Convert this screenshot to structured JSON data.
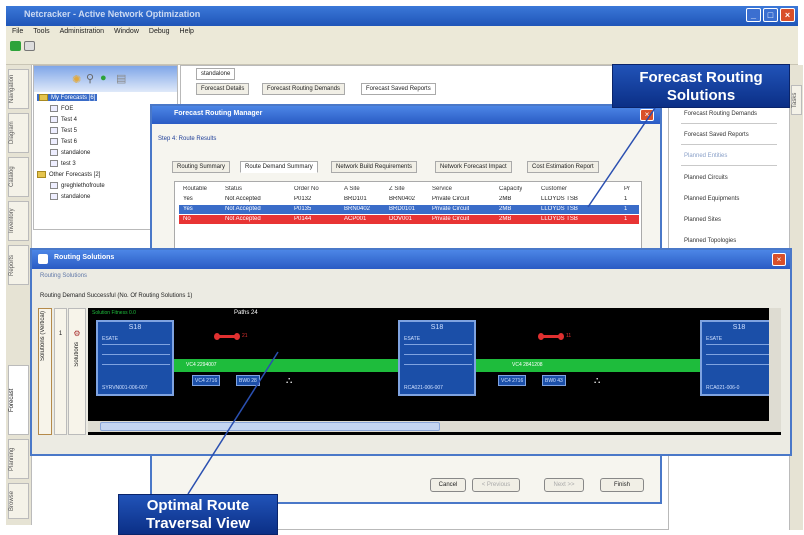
{
  "window": {
    "title": "Netcracker - Active Network Optimization",
    "controls": [
      "_",
      "□",
      "×"
    ]
  },
  "menu": [
    "File",
    "Tools",
    "Administration",
    "Window",
    "Debug",
    "Help"
  ],
  "left_rail_tabs": [
    "Navigation",
    "Diagram",
    "Catalog",
    "Inventory",
    "Reports",
    "Forecast",
    "Planning",
    "Browse"
  ],
  "tree": {
    "items": [
      {
        "label": "My Forecasts [6]",
        "type": "folder"
      },
      {
        "label": "FOE",
        "type": "node"
      },
      {
        "label": "Test 4",
        "type": "node"
      },
      {
        "label": "Test 5",
        "type": "node"
      },
      {
        "label": "Test 6",
        "type": "node"
      },
      {
        "label": "standalone",
        "type": "node"
      },
      {
        "label": "test 3",
        "type": "node"
      },
      {
        "label": "Other Forecasts [2]",
        "type": "folder"
      },
      {
        "label": "greghlethofroute",
        "type": "node"
      },
      {
        "label": "standalone",
        "type": "node"
      }
    ]
  },
  "center": {
    "editor_tab": "standalone",
    "sub_tabs": [
      "Forecast Details",
      "Forecast Routing Demands",
      "Forecast Saved Reports"
    ]
  },
  "right_panel": {
    "items": [
      "Forecast Routing Demands",
      "Forecast Saved Reports",
      "Planned Entities",
      "Planned Circuits",
      "Planned Equipments",
      "Planned Sites",
      "Planned Topologies"
    ],
    "side_tab": "Tasks"
  },
  "forecast_dialog": {
    "title": "Forecast Routing Manager",
    "step": "Step 4: Route Results",
    "tabs": [
      "Routing Summary",
      "Route Demand Summary",
      "Network Build Requirements",
      "Network Forecast Impact",
      "Cost Estimation Report"
    ],
    "active_tab": 1,
    "table": {
      "columns": [
        "Routable",
        "Status",
        "Order No",
        "A Site",
        "Z Site",
        "Service",
        "Capacity",
        "Customer",
        "Pr"
      ],
      "rows": [
        {
          "cells": [
            "Yes",
            "Not Accepted",
            "P0132",
            "BRD101",
            "BRN0402",
            "Private Circuit",
            "2MB",
            "LLOYDS TSB",
            "1"
          ],
          "state": "normal"
        },
        {
          "cells": [
            "Yes",
            "Not Accepted",
            "P0135",
            "BRN0402",
            "BRD0101",
            "Private Circuit",
            "2MB",
            "LLOYDS TSB",
            "1"
          ],
          "state": "selected"
        },
        {
          "cells": [
            "No",
            "Not Accepted",
            "P0144",
            "ACP001",
            "DOV001",
            "Private Circuit",
            "2MB",
            "LLOYDS TSB",
            "1"
          ],
          "state": "error"
        }
      ]
    },
    "buttons": [
      {
        "label": "Cancel",
        "enabled": true
      },
      {
        "label": "< Previous",
        "enabled": false
      },
      {
        "label": "Next >>",
        "enabled": false
      },
      {
        "label": "Finish",
        "enabled": true
      }
    ]
  },
  "routing_dialog": {
    "title": "Routing Solutions",
    "section": "Routing Solutions",
    "summary": "Routing Demand Successful (No. Of Routing Solutions 1)",
    "side_tab": "Solutions (Vertical)",
    "side_row_labels": [
      "1",
      "Solutions"
    ],
    "header_left": "Solution Fitness 0.0",
    "header_paths": "Paths 24",
    "nodes": [
      {
        "label": "S18",
        "sub": "ESATE",
        "footer": "SYRVN001-006-007"
      },
      {
        "label": "S18",
        "sub": "ESATE",
        "footer": "RCA021-006-007"
      },
      {
        "label": "S18",
        "sub": "ESATE",
        "footer": "RCA021-006-0"
      }
    ],
    "links": [
      "VC4 2294007",
      "VC4 2841208"
    ],
    "info_boxes": [
      {
        "left": "VC4 2716",
        "right": "BW0 28"
      },
      {
        "left": "VC4 2716",
        "right": "BW0 43"
      }
    ],
    "dumbbell_labels": [
      "21",
      "11"
    ]
  },
  "callouts": {
    "top_right": [
      "Forecast Routing",
      "Solutions"
    ],
    "bottom": [
      "Optimal Route",
      "Traversal View"
    ]
  },
  "colors": {
    "title_blue": "#2a5bc4",
    "selection_blue": "#3a6cc8",
    "error_red": "#e83434",
    "link_green": "#1ebc3c",
    "callout_navy": "#0b2f86"
  }
}
